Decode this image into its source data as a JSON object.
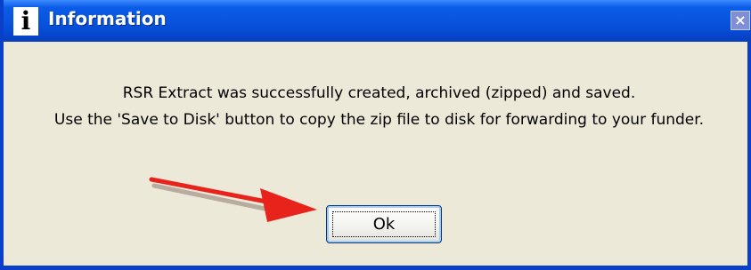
{
  "window": {
    "title": "Information",
    "title_icon": "info-icon",
    "title_icon_glyph": "i",
    "close_glyph": "×"
  },
  "message": {
    "line1": "RSR Extract was successfully created, archived (zipped) and saved.",
    "line2": "Use the 'Save to Disk' button to copy the zip file to disk for forwarding to your funder."
  },
  "buttons": {
    "ok_label": "Ok"
  },
  "annotation": {
    "icon": "red-arrow-icon",
    "color": "#e8231c"
  },
  "colors": {
    "titlebar": "#0853de",
    "dialog_bg": "#ece9d8",
    "close_button": "#7e8fd8"
  }
}
